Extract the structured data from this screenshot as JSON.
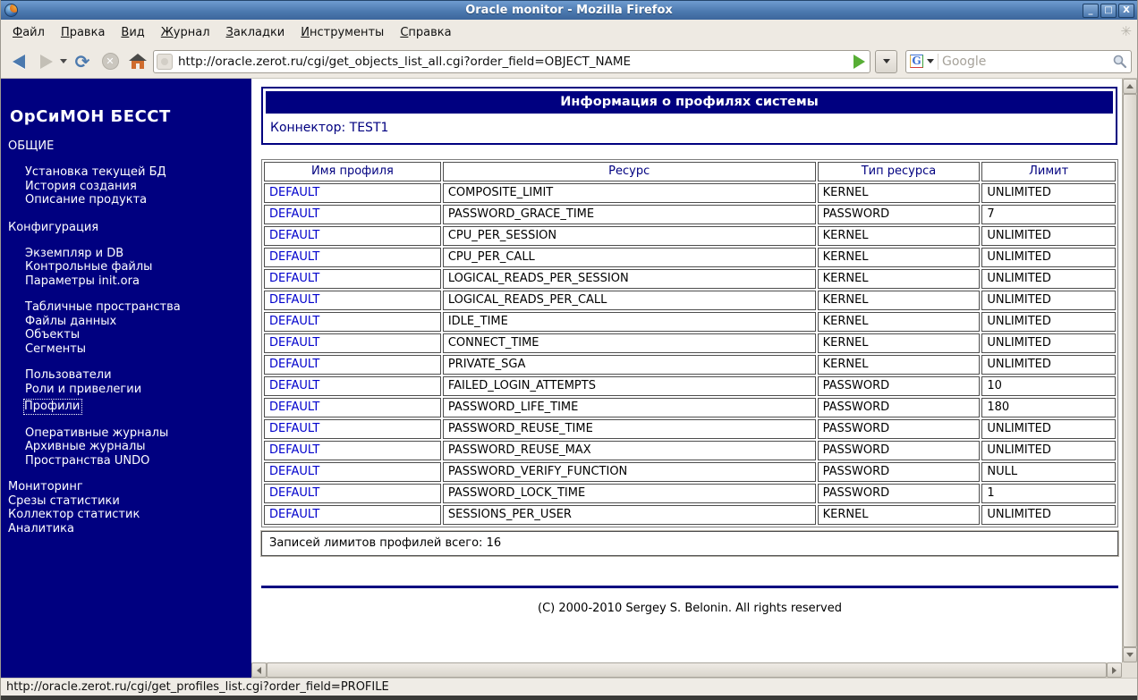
{
  "window": {
    "title": "Oracle monitor - Mozilla Firefox",
    "controls": {
      "minimize": "_",
      "maximize": "□",
      "close": "X"
    }
  },
  "menubar": {
    "items": [
      "Файл",
      "Правка",
      "Вид",
      "Журнал",
      "Закладки",
      "Инструменты",
      "Справка"
    ]
  },
  "toolbar": {
    "url_value": "http://oracle.zerot.ru/cgi/get_objects_list_all.cgi?order_field=OBJECT_NAME",
    "search_placeholder": "Google",
    "search_engine_letter": "G"
  },
  "sidebar": {
    "title": "ОрСиМОН БЕССТ",
    "blocks": [
      {
        "type": "header",
        "label": "ОБЩИЕ"
      },
      {
        "type": "links",
        "items": [
          "Установка текущей БД",
          "История создания",
          "Описание продукта"
        ]
      },
      {
        "type": "header",
        "label": "Конфигурация"
      },
      {
        "type": "links",
        "items": [
          "Экземпляр и DB",
          "Контрольные файлы",
          "Параметры init.ora"
        ]
      },
      {
        "type": "links",
        "items": [
          "Табличные пространства",
          "Файлы данных",
          "Объекты",
          "Сегменты"
        ]
      },
      {
        "type": "links",
        "items": [
          "Пользователи",
          "Роли и привелегии",
          "Профили"
        ],
        "active": "Профили"
      },
      {
        "type": "links",
        "items": [
          "Оперативные журналы",
          "Архивные журналы",
          "Пространства UNDO"
        ]
      },
      {
        "type": "rootlinks",
        "items": [
          "Мониторинг",
          "Срезы статистики",
          "Коллектор статистик",
          "Аналитика"
        ]
      }
    ]
  },
  "main": {
    "panel_title": "Информация о профилях системы",
    "connector": "Коннектор: TEST1",
    "table": {
      "headers": [
        "Имя профиля",
        "Ресурс",
        "Тип ресурса",
        "Лимит"
      ],
      "rows": [
        [
          "DEFAULT",
          "COMPOSITE_LIMIT",
          "KERNEL",
          "UNLIMITED"
        ],
        [
          "DEFAULT",
          "PASSWORD_GRACE_TIME",
          "PASSWORD",
          "7"
        ],
        [
          "DEFAULT",
          "CPU_PER_SESSION",
          "KERNEL",
          "UNLIMITED"
        ],
        [
          "DEFAULT",
          "CPU_PER_CALL",
          "KERNEL",
          "UNLIMITED"
        ],
        [
          "DEFAULT",
          "LOGICAL_READS_PER_SESSION",
          "KERNEL",
          "UNLIMITED"
        ],
        [
          "DEFAULT",
          "LOGICAL_READS_PER_CALL",
          "KERNEL",
          "UNLIMITED"
        ],
        [
          "DEFAULT",
          "IDLE_TIME",
          "KERNEL",
          "UNLIMITED"
        ],
        [
          "DEFAULT",
          "CONNECT_TIME",
          "KERNEL",
          "UNLIMITED"
        ],
        [
          "DEFAULT",
          "PRIVATE_SGA",
          "KERNEL",
          "UNLIMITED"
        ],
        [
          "DEFAULT",
          "FAILED_LOGIN_ATTEMPTS",
          "PASSWORD",
          "10"
        ],
        [
          "DEFAULT",
          "PASSWORD_LIFE_TIME",
          "PASSWORD",
          "180"
        ],
        [
          "DEFAULT",
          "PASSWORD_REUSE_TIME",
          "PASSWORD",
          "UNLIMITED"
        ],
        [
          "DEFAULT",
          "PASSWORD_REUSE_MAX",
          "PASSWORD",
          "UNLIMITED"
        ],
        [
          "DEFAULT",
          "PASSWORD_VERIFY_FUNCTION",
          "PASSWORD",
          "NULL"
        ],
        [
          "DEFAULT",
          "PASSWORD_LOCK_TIME",
          "PASSWORD",
          "1"
        ],
        [
          "DEFAULT",
          "SESSIONS_PER_USER",
          "KERNEL",
          "UNLIMITED"
        ]
      ]
    },
    "summary": "Записей лимитов профилей всего: 16",
    "copyright": "(C) 2000-2010 Sergey S. Belonin. All rights reserved"
  },
  "statusbar": {
    "text": "http://oracle.zerot.ru/cgi/get_profiles_list.cgi?order_field=PROFILE"
  },
  "colors": {
    "accent_navy": "#000080",
    "link_blue": "#0000cc",
    "titlebar_blue": "#4a77ad",
    "go_green": "#57ae35"
  }
}
